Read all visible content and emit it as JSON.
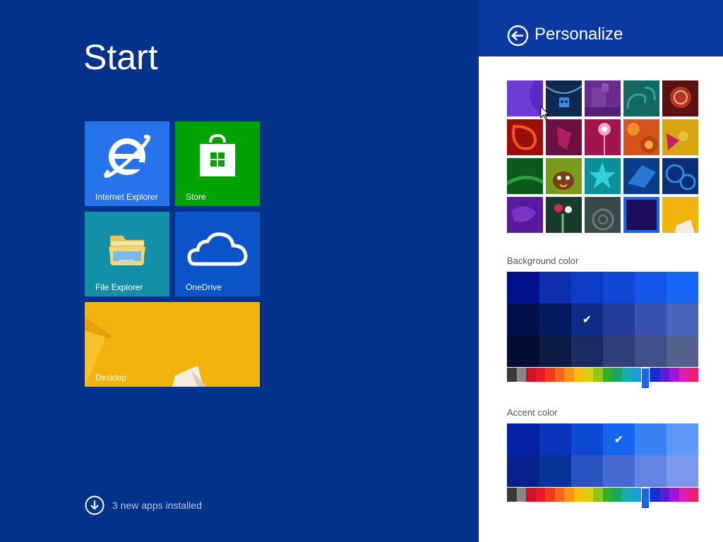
{
  "start": {
    "title": "Start",
    "tiles": [
      {
        "label": "Internet Explorer",
        "color": "#2673ec",
        "icon": "internet-explorer-icon"
      },
      {
        "label": "Store",
        "color": "#00a300",
        "icon": "store-icon"
      },
      {
        "label": "File Explorer",
        "color": "#1390a8",
        "icon": "folder-icon"
      },
      {
        "label": "OneDrive",
        "color": "#0a53c9",
        "icon": "cloud-icon"
      },
      {
        "label": "Desktop",
        "color": "#f1b40c",
        "icon": "desktop-wallpaper"
      }
    ],
    "apps_installed": "3 new apps installed"
  },
  "pane": {
    "title": "Personalize",
    "background_label": "Background color",
    "accent_label": "Accent color",
    "selected_pattern": 18,
    "background_swatches": [
      [
        "#00108c",
        "#0e2fb0",
        "#0c3cc5",
        "#1148d6",
        "#1556e8",
        "#1766f5"
      ],
      [
        "#030f4f",
        "#061a61",
        "#0c2c87",
        "#243c9a",
        "#3852ad",
        "#4a63bb"
      ],
      [
        "#050d34",
        "#0c1a45",
        "#1c2a62",
        "#30407a",
        "#42508a",
        "#54618f"
      ]
    ],
    "background_selected": [
      1,
      2
    ],
    "accent_swatches": [
      [
        "#0422a5",
        "#0934bb",
        "#0e49d6",
        "#1565f0",
        "#3b82f5",
        "#5e98f7"
      ],
      [
        "#08208e",
        "#0a3399",
        "#2a52c0",
        "#476ad2",
        "#6383e2",
        "#7b97ee"
      ]
    ],
    "accent_selected": [
      0,
      3
    ],
    "hue_colors": [
      "#3a3a3a",
      "#888888",
      "#d4102c",
      "#e8192a",
      "#f03a1e",
      "#f5661a",
      "#f99513",
      "#fbbd10",
      "#d9cf12",
      "#96c416",
      "#30b02b",
      "#17a868",
      "#14aeb8",
      "#199ed8",
      "#1565f0",
      "#1a2bd0",
      "#5b1ad6",
      "#9b17d5",
      "#e01cb4",
      "#ea1e6c"
    ],
    "hue_selected": 14
  }
}
